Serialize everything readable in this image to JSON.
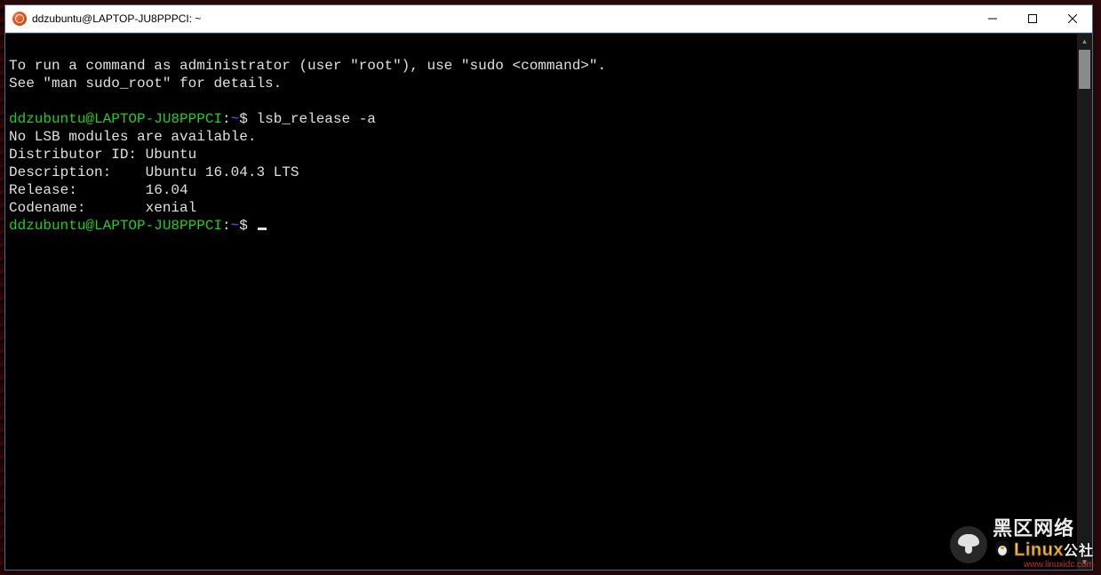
{
  "window": {
    "title": "ddzubuntu@LAPTOP-JU8PPPCI: ~"
  },
  "terminal": {
    "motd_line1": "To run a command as administrator (user \"root\"), use \"sudo <command>\".",
    "motd_line2": "See \"man sudo_root\" for details.",
    "prompt_user_host": "ddzubuntu@LAPTOP-JU8PPPCI",
    "prompt_sep": ":",
    "prompt_path": "~",
    "prompt_symbol": "$",
    "command1": "lsb_release -a",
    "out_line1": "No LSB modules are available.",
    "out_line2": "Distributor ID: Ubuntu",
    "out_line3": "Description:    Ubuntu 16.04.3 LTS",
    "out_line4": "Release:        16.04",
    "out_line5": "Codename:       xenial"
  },
  "watermark": {
    "cn": "黑区网络",
    "brand": "Linux",
    "suffix_cn": "公社",
    "url": "www.linuxidc.com"
  }
}
